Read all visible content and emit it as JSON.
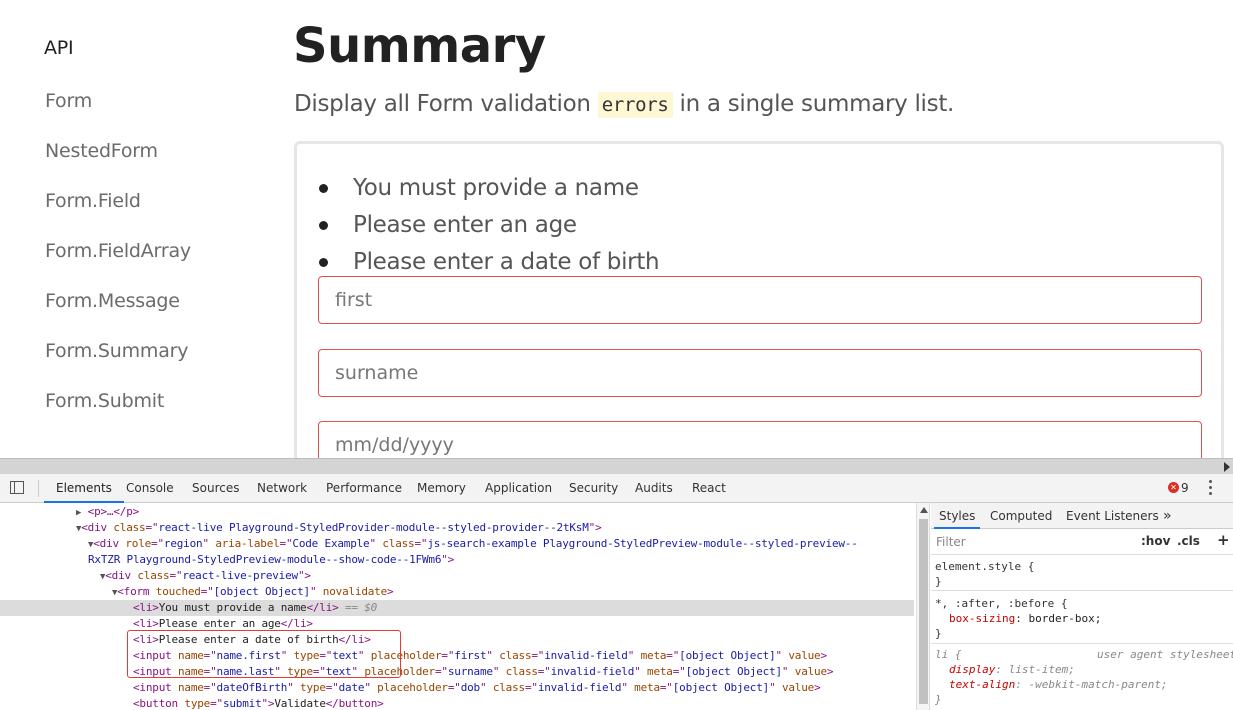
{
  "sidebar": {
    "items": [
      {
        "label": "API",
        "current": true
      },
      {
        "label": "Form"
      },
      {
        "label": "NestedForm"
      },
      {
        "label": "Form.Field"
      },
      {
        "label": "Form.FieldArray"
      },
      {
        "label": "Form.Message"
      },
      {
        "label": "Form.Summary"
      },
      {
        "label": "Form.Submit"
      }
    ]
  },
  "main": {
    "title": "Summary",
    "lead_before": "Display all Form validation ",
    "lead_code": "errors",
    "lead_after": " in a single summary list.",
    "summary_items": [
      "You must provide a name",
      "Please enter an age",
      "Please enter a date of birth"
    ],
    "fields": {
      "first_placeholder": "first",
      "surname_placeholder": "surname",
      "dob_placeholder": "mm/dd/yyyy"
    }
  },
  "devtools": {
    "tabs": [
      "Elements",
      "Console",
      "Sources",
      "Network",
      "Performance",
      "Memory",
      "Application",
      "Security",
      "Audits",
      "React"
    ],
    "active_tab": "Elements",
    "error_count": "9",
    "error_glyph": "✕",
    "styles_tabs": [
      "Styles",
      "Computed",
      "Event Listeners",
      "»"
    ],
    "filter_placeholder": "Filter",
    "hov": ":hov",
    "cls": ".cls",
    "plus": "+",
    "dom": {
      "l0": "<p>…</p>",
      "l1_class": "react-live Playground-StyledProvider-module--styled-provider--2tKsM",
      "l2_role": "region",
      "l2_aria": "Code Example",
      "l2_class_a": "js-search-example Playground-StyledPreview-module--styled-preview--",
      "l2_class_b": "RxTZR Playground-StyledPreview-module--show-code--1FWm6",
      "l3_class": "react-live-preview",
      "l4_touched": "[object Object]",
      "l4_novalidate": "novalidate",
      "li1": "You must provide a name",
      "li_eq": " == $0",
      "li2": "Please enter an age",
      "li3": "Please enter a date of birth",
      "in1_name": "name.first",
      "in1_type": "text",
      "in1_ph": "first",
      "in2_name": "name.last",
      "in2_type": "text",
      "in2_ph": "surname",
      "in3_name": "dateOfBirth",
      "in3_type": "date",
      "in3_ph": "dob",
      "in_class": "invalid-field",
      "in_meta": "[object Object]",
      "in_value": "value",
      "btn_type": "submit",
      "btn_text": "Validate"
    },
    "rules": {
      "r1_selector": "element.style {",
      "r1_close": "}",
      "r2_selector": "*, :after, :before {",
      "r2_prop": "box-sizing",
      "r2_val": "border-box;",
      "r2_close": "}",
      "r3_selector": "li {",
      "r3_origin": "user agent stylesheet",
      "r3_p1": "display",
      "r3_v1": "list-item;",
      "r3_p2": "text-align",
      "r3_v2": "-webkit-match-parent;",
      "r3_close": "}"
    }
  }
}
